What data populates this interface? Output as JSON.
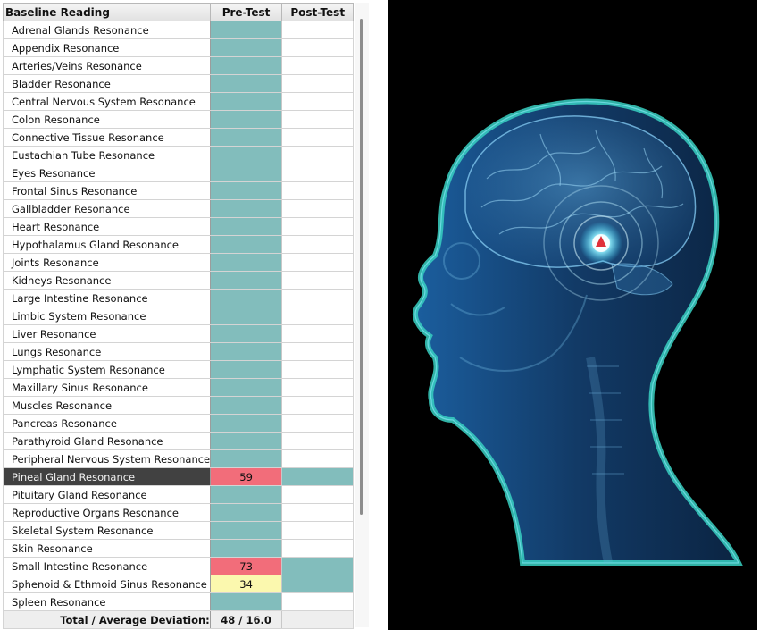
{
  "grid": {
    "columns": {
      "name": "Baseline Reading",
      "pre": "Pre-Test",
      "post": "Post-Test"
    },
    "rows": [
      {
        "name": "Adrenal Glands Resonance",
        "pre": "",
        "pre_state": "teal",
        "post": "",
        "post_state": "empty"
      },
      {
        "name": "Appendix Resonance",
        "pre": "",
        "pre_state": "teal",
        "post": "",
        "post_state": "empty"
      },
      {
        "name": "Arteries/Veins Resonance",
        "pre": "",
        "pre_state": "teal",
        "post": "",
        "post_state": "empty"
      },
      {
        "name": "Bladder Resonance",
        "pre": "",
        "pre_state": "teal",
        "post": "",
        "post_state": "empty"
      },
      {
        "name": "Central Nervous System  Resonance",
        "pre": "",
        "pre_state": "teal",
        "post": "",
        "post_state": "empty"
      },
      {
        "name": "Colon Resonance",
        "pre": "",
        "pre_state": "teal",
        "post": "",
        "post_state": "empty"
      },
      {
        "name": "Connective Tissue Resonance",
        "pre": "",
        "pre_state": "teal",
        "post": "",
        "post_state": "empty"
      },
      {
        "name": "Eustachian Tube Resonance",
        "pre": "",
        "pre_state": "teal",
        "post": "",
        "post_state": "empty"
      },
      {
        "name": "Eyes Resonance",
        "pre": "",
        "pre_state": "teal",
        "post": "",
        "post_state": "empty"
      },
      {
        "name": "Frontal Sinus Resonance",
        "pre": "",
        "pre_state": "teal",
        "post": "",
        "post_state": "empty"
      },
      {
        "name": "Gallbladder Resonance",
        "pre": "",
        "pre_state": "teal",
        "post": "",
        "post_state": "empty"
      },
      {
        "name": "Heart Resonance",
        "pre": "",
        "pre_state": "teal",
        "post": "",
        "post_state": "empty"
      },
      {
        "name": "Hypothalamus Gland Resonance",
        "pre": "",
        "pre_state": "teal",
        "post": "",
        "post_state": "empty"
      },
      {
        "name": "Joints Resonance",
        "pre": "",
        "pre_state": "teal",
        "post": "",
        "post_state": "empty"
      },
      {
        "name": "Kidneys Resonance",
        "pre": "",
        "pre_state": "teal",
        "post": "",
        "post_state": "empty"
      },
      {
        "name": "Large Intestine Resonance",
        "pre": "",
        "pre_state": "teal",
        "post": "",
        "post_state": "empty"
      },
      {
        "name": "Limbic System Resonance",
        "pre": "",
        "pre_state": "teal",
        "post": "",
        "post_state": "empty"
      },
      {
        "name": "Liver Resonance",
        "pre": "",
        "pre_state": "teal",
        "post": "",
        "post_state": "empty"
      },
      {
        "name": "Lungs Resonance",
        "pre": "",
        "pre_state": "teal",
        "post": "",
        "post_state": "empty"
      },
      {
        "name": "Lymphatic System Resonance",
        "pre": "",
        "pre_state": "teal",
        "post": "",
        "post_state": "empty"
      },
      {
        "name": "Maxillary Sinus Resonance",
        "pre": "",
        "pre_state": "teal",
        "post": "",
        "post_state": "empty"
      },
      {
        "name": "Muscles Resonance",
        "pre": "",
        "pre_state": "teal",
        "post": "",
        "post_state": "empty"
      },
      {
        "name": "Pancreas Resonance",
        "pre": "",
        "pre_state": "teal",
        "post": "",
        "post_state": "empty"
      },
      {
        "name": "Parathyroid Gland Resonance",
        "pre": "",
        "pre_state": "teal",
        "post": "",
        "post_state": "empty"
      },
      {
        "name": "Peripheral Nervous System Resonance",
        "pre": "",
        "pre_state": "teal",
        "post": "",
        "post_state": "empty"
      },
      {
        "name": "Pineal Gland Resonance",
        "pre": "59",
        "pre_state": "red",
        "post": "",
        "post_state": "teal",
        "selected": true
      },
      {
        "name": "Pituitary Gland Resonance",
        "pre": "",
        "pre_state": "teal",
        "post": "",
        "post_state": "empty"
      },
      {
        "name": "Reproductive Organs Resonance",
        "pre": "",
        "pre_state": "teal",
        "post": "",
        "post_state": "empty"
      },
      {
        "name": "Skeletal System Resonance",
        "pre": "",
        "pre_state": "teal",
        "post": "",
        "post_state": "empty"
      },
      {
        "name": "Skin Resonance",
        "pre": "",
        "pre_state": "teal",
        "post": "",
        "post_state": "empty"
      },
      {
        "name": "Small Intestine Resonance",
        "pre": "73",
        "pre_state": "red",
        "post": "",
        "post_state": "teal"
      },
      {
        "name": "Sphenoid & Ethmoid Sinus Resonance",
        "pre": "34",
        "pre_state": "yellow",
        "post": "",
        "post_state": "teal"
      },
      {
        "name": "Spleen Resonance",
        "pre": "",
        "pre_state": "teal",
        "post": "",
        "post_state": "empty"
      }
    ],
    "total": {
      "label": "Total / Average Deviation:",
      "pre": "48 / 16.0",
      "post": ""
    }
  },
  "colors": {
    "teal": "#82bdbc",
    "red": "#f26d7a",
    "yellow": "#fbf8ae",
    "selected_row": "#414141",
    "viewer_background": "#000000",
    "hologram_blue": "#1f6fb0",
    "hologram_edge": "#3ad6c6",
    "target_marker": "#e0313a"
  },
  "viewer": {
    "image": "head-brain-scan-icon",
    "target": "pineal-gland-target-icon"
  },
  "scrollbar": {
    "position_fraction": 0.0
  }
}
